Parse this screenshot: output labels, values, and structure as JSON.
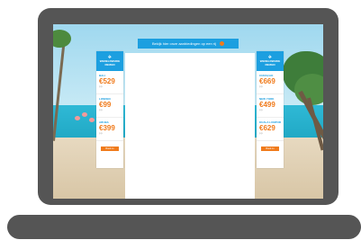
{
  "banner": {
    "text": "Bekijk hier onze aanbiedingen op een rij"
  },
  "ad_left": {
    "logo_line1": "WERELDWIJDE",
    "logo_line2": "REIZEN",
    "deals": [
      {
        "city": "BALI",
        "price": "€529",
        "sub": "p.p."
      },
      {
        "city": "LONDEN",
        "price": "€99",
        "sub": "p.p."
      },
      {
        "city": "ARUBA",
        "price": "€399",
        "sub": "p.p."
      }
    ],
    "cta": "Boek nu"
  },
  "ad_right": {
    "logo_line1": "WERELDWIJDE",
    "logo_line2": "REIZEN",
    "deals": [
      {
        "city": "CURAÇAO",
        "price": "€669",
        "sub": "p.p."
      },
      {
        "city": "NEW YORK",
        "price": "€499",
        "sub": "p.p."
      },
      {
        "city": "KUALA LUMPUR",
        "price": "€629",
        "sub": "p.p."
      }
    ],
    "cta": "Boek nu"
  },
  "colors": {
    "brand_blue": "#1c9fe0",
    "accent_orange": "#f07b1c",
    "device_gray": "#555555"
  }
}
